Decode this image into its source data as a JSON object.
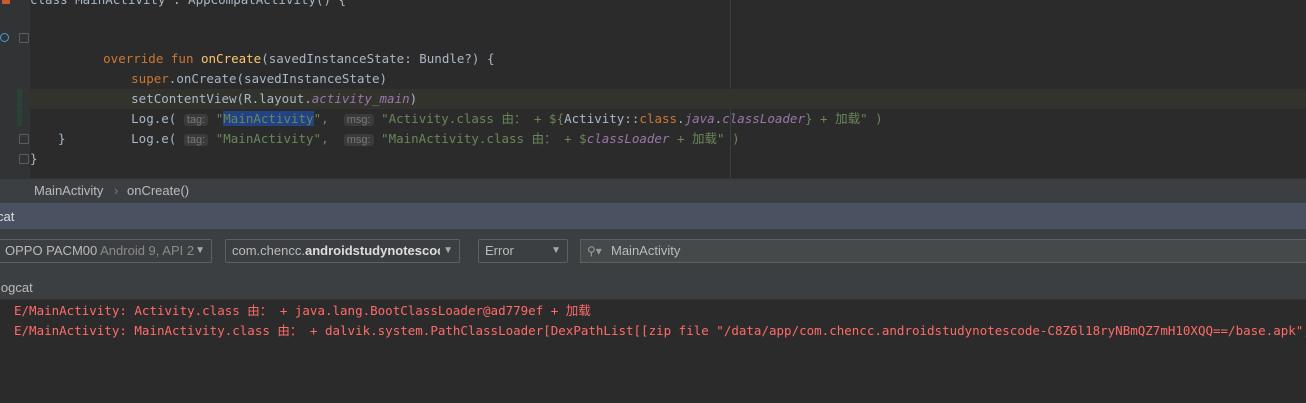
{
  "editor": {
    "top_line": "class MainActivity : AppCompatActivity() {",
    "line_override_kw": "override fun ",
    "line_override_fn": "onCreate",
    "line_override_rest": "(savedInstanceState: Bundle?) {",
    "line_super_kw": "super",
    "line_super_rest": ".onCreate(savedInstanceState)",
    "line_setcontent_a": "setContentView(R.layout.",
    "line_setcontent_b": "activity_main",
    "line_setcontent_c": ")",
    "log1_a": "Log.e( ",
    "log1_tag_hint": "tag:",
    "log1_tag_q1": " \"",
    "log1_tag_sel": "MainActivity",
    "log1_tag_q2": "\",",
    "log1_msg_hint": "msg:",
    "log1_msg_a": " \"Activity.class 由： + ${",
    "log1_msg_b": "Activity::",
    "log1_msg_c": "class",
    "log1_msg_d": ".",
    "log1_msg_e": "java",
    "log1_msg_f": ".",
    "log1_msg_g": "classLoader",
    "log1_msg_h": "} + 加载\" )",
    "log2_a": "Log.e( ",
    "log2_tag_hint": "tag:",
    "log2_tag": " \"MainActivity\",",
    "log2_msg_hint": "msg:",
    "log2_msg_a": " \"MainActivity.class 由： + $",
    "log2_msg_b": "classLoader",
    "log2_msg_c": " + 加载\" )",
    "close_inner": "}",
    "close_outer": "}"
  },
  "breadcrumb": {
    "class": "MainActivity",
    "separator": "›",
    "method": "onCreate()"
  },
  "logcat": {
    "title": "cat",
    "device": {
      "name": "OPPO PACM00",
      "detail": "Android 9, API 2"
    },
    "process": {
      "prefix": "com.chencc.",
      "bold": "androidstudynotescoc"
    },
    "level": "Error",
    "search_value": "MainActivity",
    "tab_label": "logcat",
    "lines": [
      "E/MainActivity: Activity.class 由： + java.lang.BootClassLoader@ad779ef + 加载",
      "E/MainActivity: MainActivity.class 由： + dalvik.system.PathClassLoader[DexPathList[[zip file \"/data/app/com.chencc.androidstudynotescode-C8Z6l18ryNBmQZ7mH10XQQ==/base.apk\", dex file \"/"
    ]
  },
  "colors": {
    "error_text": "#ff6b68",
    "keyword": "#cc7832",
    "function": "#ffc66d",
    "string": "#6a8759",
    "field": "#9876aa",
    "logcat_header": "#4a5161"
  },
  "icons": [
    "bookmark-icon",
    "override-gutter-icon",
    "fold-icon",
    "search-icon",
    "chevron-down-icon"
  ]
}
